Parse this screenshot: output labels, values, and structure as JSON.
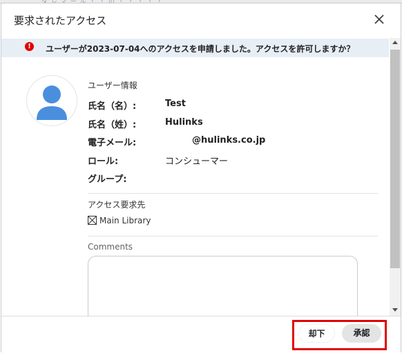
{
  "dialog": {
    "title": "要求されたアクセス",
    "banner": "ユーザーが2023-07-04へのアクセスを申請しました。アクセスを許可しますか？"
  },
  "user_info": {
    "heading": "ユーザー情報",
    "first_name_label": "氏名（名）:",
    "first_name_value": "Test",
    "last_name_label": "氏名（姓）:",
    "last_name_value": "Hulinks",
    "email_label": "電子メール:",
    "email_value": "@hulinks.co.jp",
    "role_label": "ロール:",
    "role_value": "コンシューマー",
    "group_label": "グループ:",
    "group_value": ""
  },
  "access": {
    "heading": "アクセス要求先",
    "library": "Main Library"
  },
  "comments": {
    "label": "Comments",
    "value": ""
  },
  "buttons": {
    "reject": "却下",
    "approve": "承認"
  },
  "colors": {
    "alert_red": "#e10000",
    "avatar_blue": "#4a8fde",
    "banner_bg": "#e8eef6"
  }
}
